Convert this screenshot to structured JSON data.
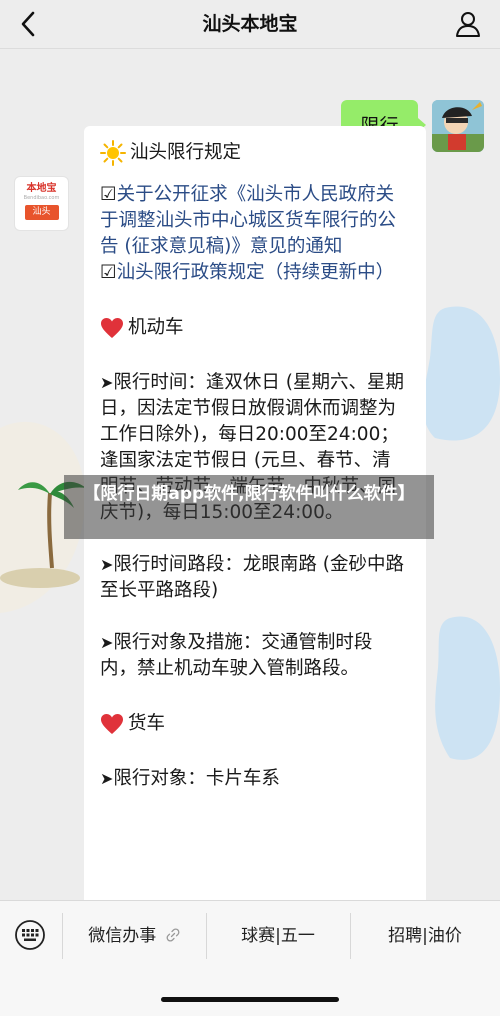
{
  "header": {
    "title": "汕头本地宝"
  },
  "chat": {
    "user_message": "限行",
    "bot_avatar": {
      "line1": "本地宝",
      "line2": "Bendibao.com",
      "line3": "汕头"
    },
    "reply": {
      "title": "汕头限行规定",
      "link1": "关于公开征求《汕头市人民政府关于调整汕头市中心城区货车限行的公告 (征求意见稿)》意见的通知",
      "link2": "汕头限行政策规定（持续更新中）",
      "section1": "机动车",
      "item1": "限行时间：逢双休日 (星期六、星期日，因法定节假日放假调休而调整为工作日除外)，每日20:00至24:00；逢国家法定节假日 (元旦、春节、清明节、劳动节、端午节、中秋节、国庆节)，每日15:00至24:00。",
      "item2": "限行时间路段：龙眼南路 (金砂中路至长平路路段)",
      "item3": "限行对象及措施：交通管制时段内，禁止机动车驶入管制路段。",
      "section2": "货车",
      "item4": "限行对象：卡片车系"
    }
  },
  "overlay": {
    "text": "【限行日期app软件,限行软件叫什么软件】"
  },
  "bottom_menu": {
    "items": [
      {
        "label": "微信办事"
      },
      {
        "label": "球赛|五一"
      },
      {
        "label": "招聘|油价"
      }
    ]
  },
  "colors": {
    "bubble": "#95ec69",
    "link": "#2b4c86",
    "heart": "#e0323a",
    "background": "#ededed"
  }
}
